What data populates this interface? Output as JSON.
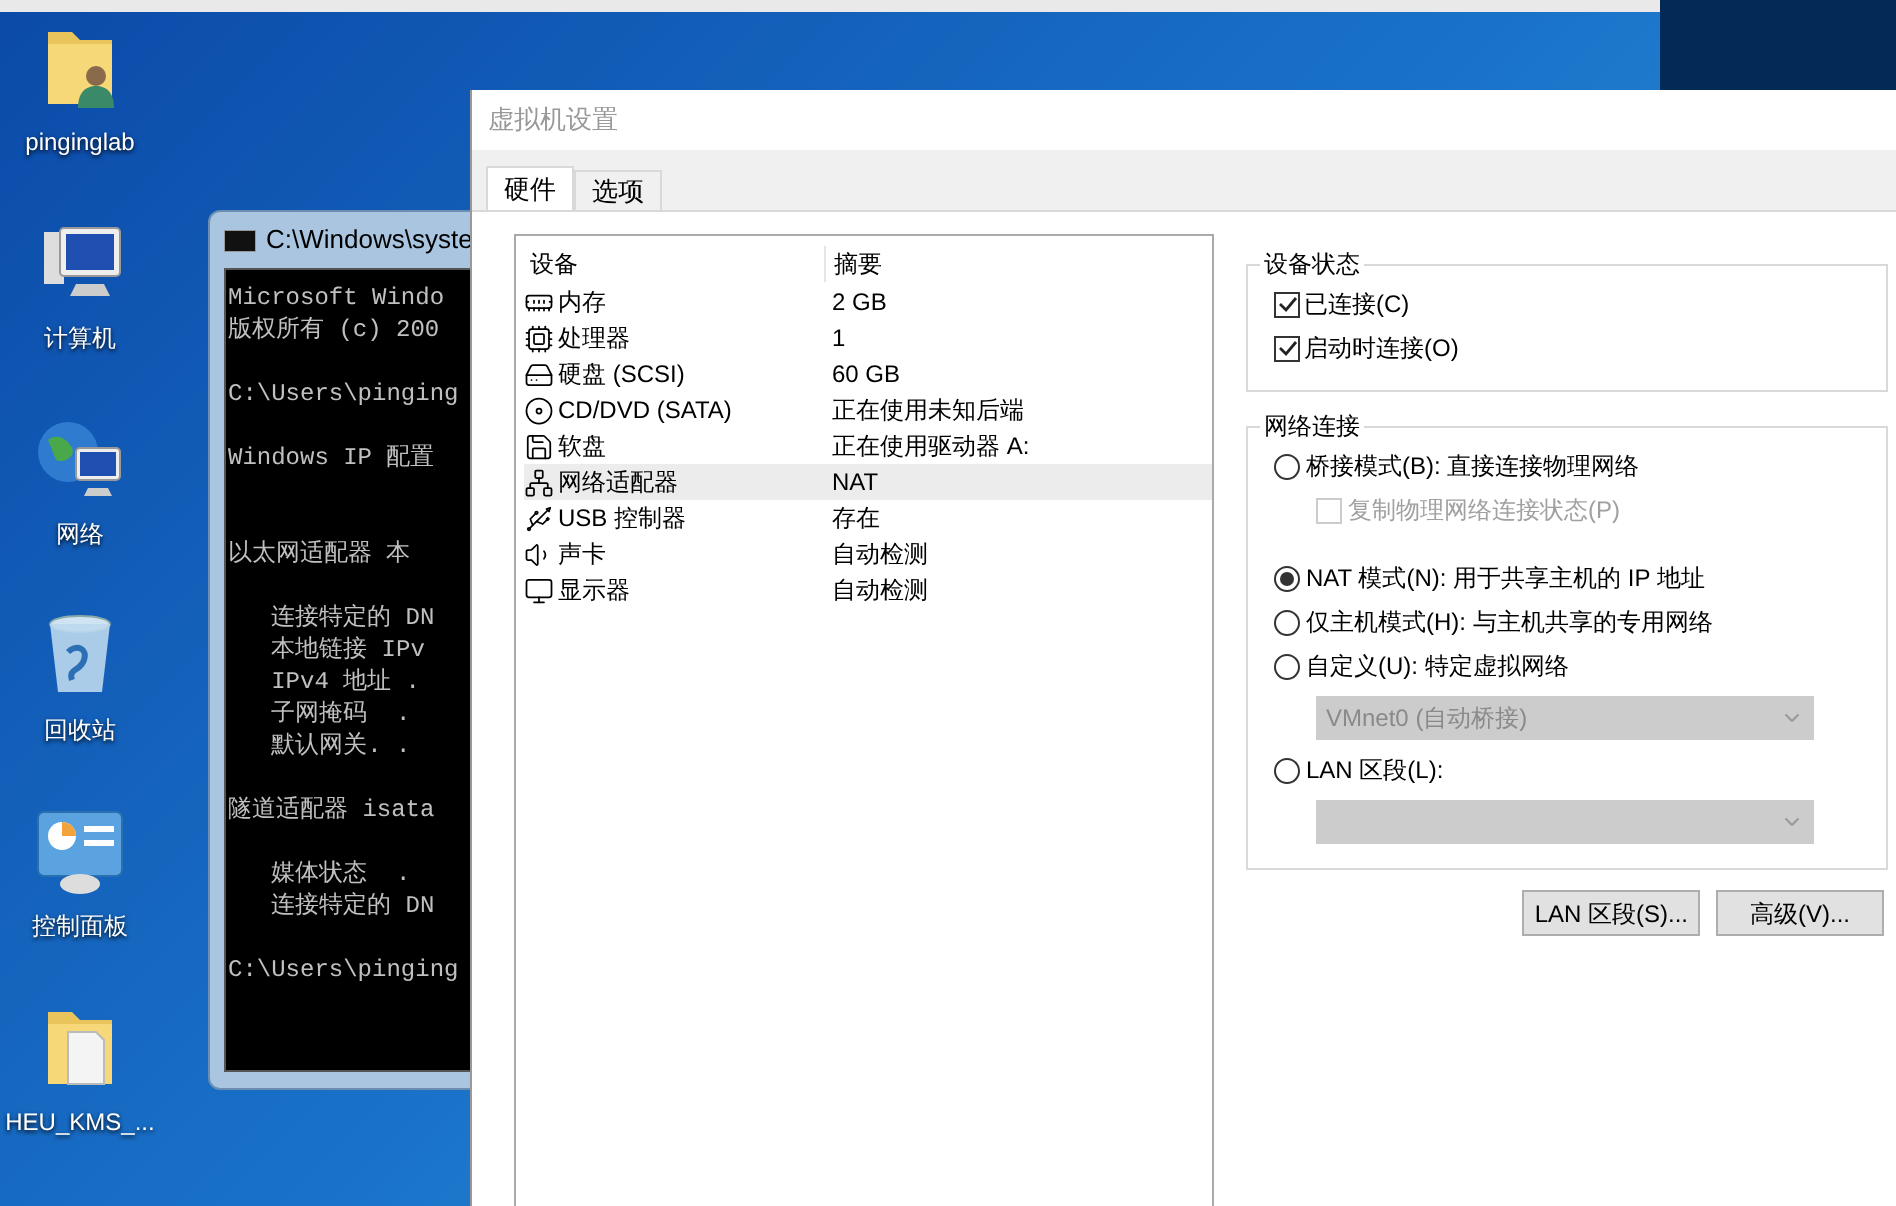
{
  "desktop_icons": [
    {
      "label": "pinginglab"
    },
    {
      "label": "计算机"
    },
    {
      "label": "网络"
    },
    {
      "label": "回收站"
    },
    {
      "label": "控制面板"
    },
    {
      "label": "HEU_KMS_..."
    }
  ],
  "console": {
    "title": "C:\\Windows\\syste",
    "blocks": [
      [
        "Microsoft Windo",
        "版权所有 (c) 200"
      ],
      [
        "C:\\Users\\pinging"
      ],
      [
        "Windows IP 配置"
      ],
      [
        "以太网适配器 本"
      ],
      [
        "   连接特定的 DN",
        "   本地链接 IPv",
        "   IPv4 地址 .",
        "   子网掩码  .",
        "   默认网关. ."
      ],
      [
        "隧道适配器 isata"
      ],
      [
        "   媒体状态  .",
        "   连接特定的 DN"
      ],
      [
        "C:\\Users\\pinging"
      ]
    ]
  },
  "dialog": {
    "title": "虚拟机设置",
    "tabs": [
      {
        "label": "硬件",
        "selected": true
      },
      {
        "label": "选项",
        "selected": false
      }
    ],
    "device_table": {
      "columns": [
        "设备",
        "摘要"
      ],
      "rows": [
        {
          "device": "内存",
          "summary": "2 GB",
          "selected": false
        },
        {
          "device": "处理器",
          "summary": "1",
          "selected": false
        },
        {
          "device": "硬盘 (SCSI)",
          "summary": "60 GB",
          "selected": false
        },
        {
          "device": "CD/DVD (SATA)",
          "summary": "正在使用未知后端",
          "selected": false
        },
        {
          "device": "软盘",
          "summary": "正在使用驱动器 A:",
          "selected": false
        },
        {
          "device": "网络适配器",
          "summary": "NAT",
          "selected": true
        },
        {
          "device": "USB 控制器",
          "summary": "存在",
          "selected": false
        },
        {
          "device": "声卡",
          "summary": "自动检测",
          "selected": false
        },
        {
          "device": "显示器",
          "summary": "自动检测",
          "selected": false
        }
      ]
    },
    "device_status": {
      "title": "设备状态",
      "items": [
        {
          "label": "已连接(C)",
          "checked": true
        },
        {
          "label": "启动时连接(O)",
          "checked": true
        }
      ]
    },
    "network_connection": {
      "title": "网络连接",
      "items": [
        {
          "kind": "radio",
          "label": "桥接模式(B): 直接连接物理网络",
          "selected": false
        },
        {
          "kind": "checkbox",
          "label": "复制物理网络连接状态(P)",
          "checked": false,
          "disabled": true
        },
        {
          "kind": "radio",
          "label": "NAT 模式(N): 用于共享主机的 IP 地址",
          "selected": true
        },
        {
          "kind": "radio",
          "label": "仅主机模式(H): 与主机共享的专用网络",
          "selected": false
        },
        {
          "kind": "radio",
          "label": "自定义(U): 特定虚拟网络",
          "selected": false
        },
        {
          "kind": "select",
          "value": "VMnet0 (自动桥接)",
          "disabled": true
        },
        {
          "kind": "radio",
          "label": "LAN 区段(L):",
          "selected": false
        },
        {
          "kind": "select",
          "disabled": true
        }
      ]
    },
    "buttons": [
      "LAN 区段(S)...",
      "高级(V)..."
    ]
  }
}
